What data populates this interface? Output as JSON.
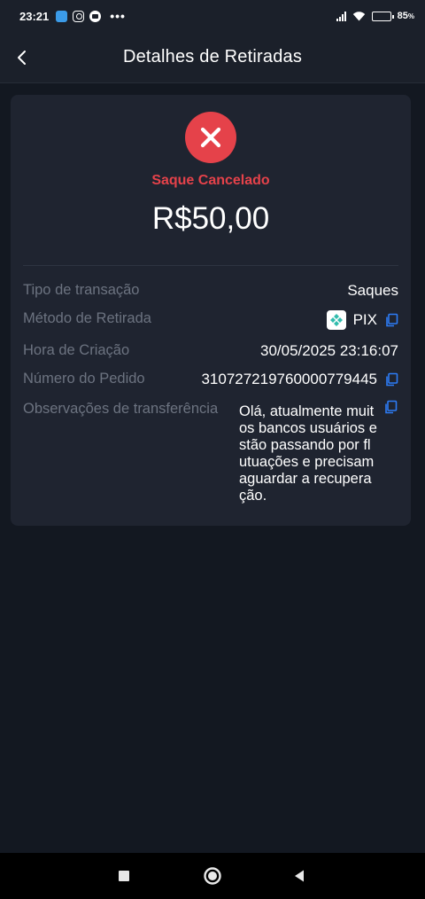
{
  "status_bar": {
    "time": "23:21",
    "battery_pct": "85",
    "battery_suffix": "%",
    "battery_level": 0.85,
    "app_icons": [
      "message-app-icon",
      "instagram-icon",
      "youtube-icon"
    ],
    "overflow": "•••"
  },
  "header": {
    "title": "Detalhes de Retiradas",
    "back_icon": "chevron-left-icon"
  },
  "summary": {
    "status_icon": "close-circle-icon",
    "status_color": "#e5424a",
    "status_label": "Saque Cancelado",
    "amount": "R$50,00"
  },
  "details": {
    "transaction_type": {
      "label": "Tipo de transação",
      "value": "Saques"
    },
    "withdraw_method": {
      "label": "Método de Retirada",
      "value": "PIX",
      "icon": "pix-icon"
    },
    "created_at": {
      "label": "Hora de Criação",
      "value": "30/05/2025 23:16:07"
    },
    "order_number": {
      "label": "Número do Pedido",
      "value": "310727219760000779445"
    },
    "transfer_notes": {
      "label": "Observações de transferência",
      "value": "Olá, atualmente muitos bancos usuários estão passando por flutuações e precisam aguardar a recuperação."
    }
  },
  "colors": {
    "background": "#131821",
    "card": "#1f2430",
    "accent_copy": "#2d7cf6",
    "label": "#6c7380"
  },
  "nav": {
    "recent": "square-icon",
    "home": "circle-icon",
    "back": "triangle-back-icon"
  }
}
